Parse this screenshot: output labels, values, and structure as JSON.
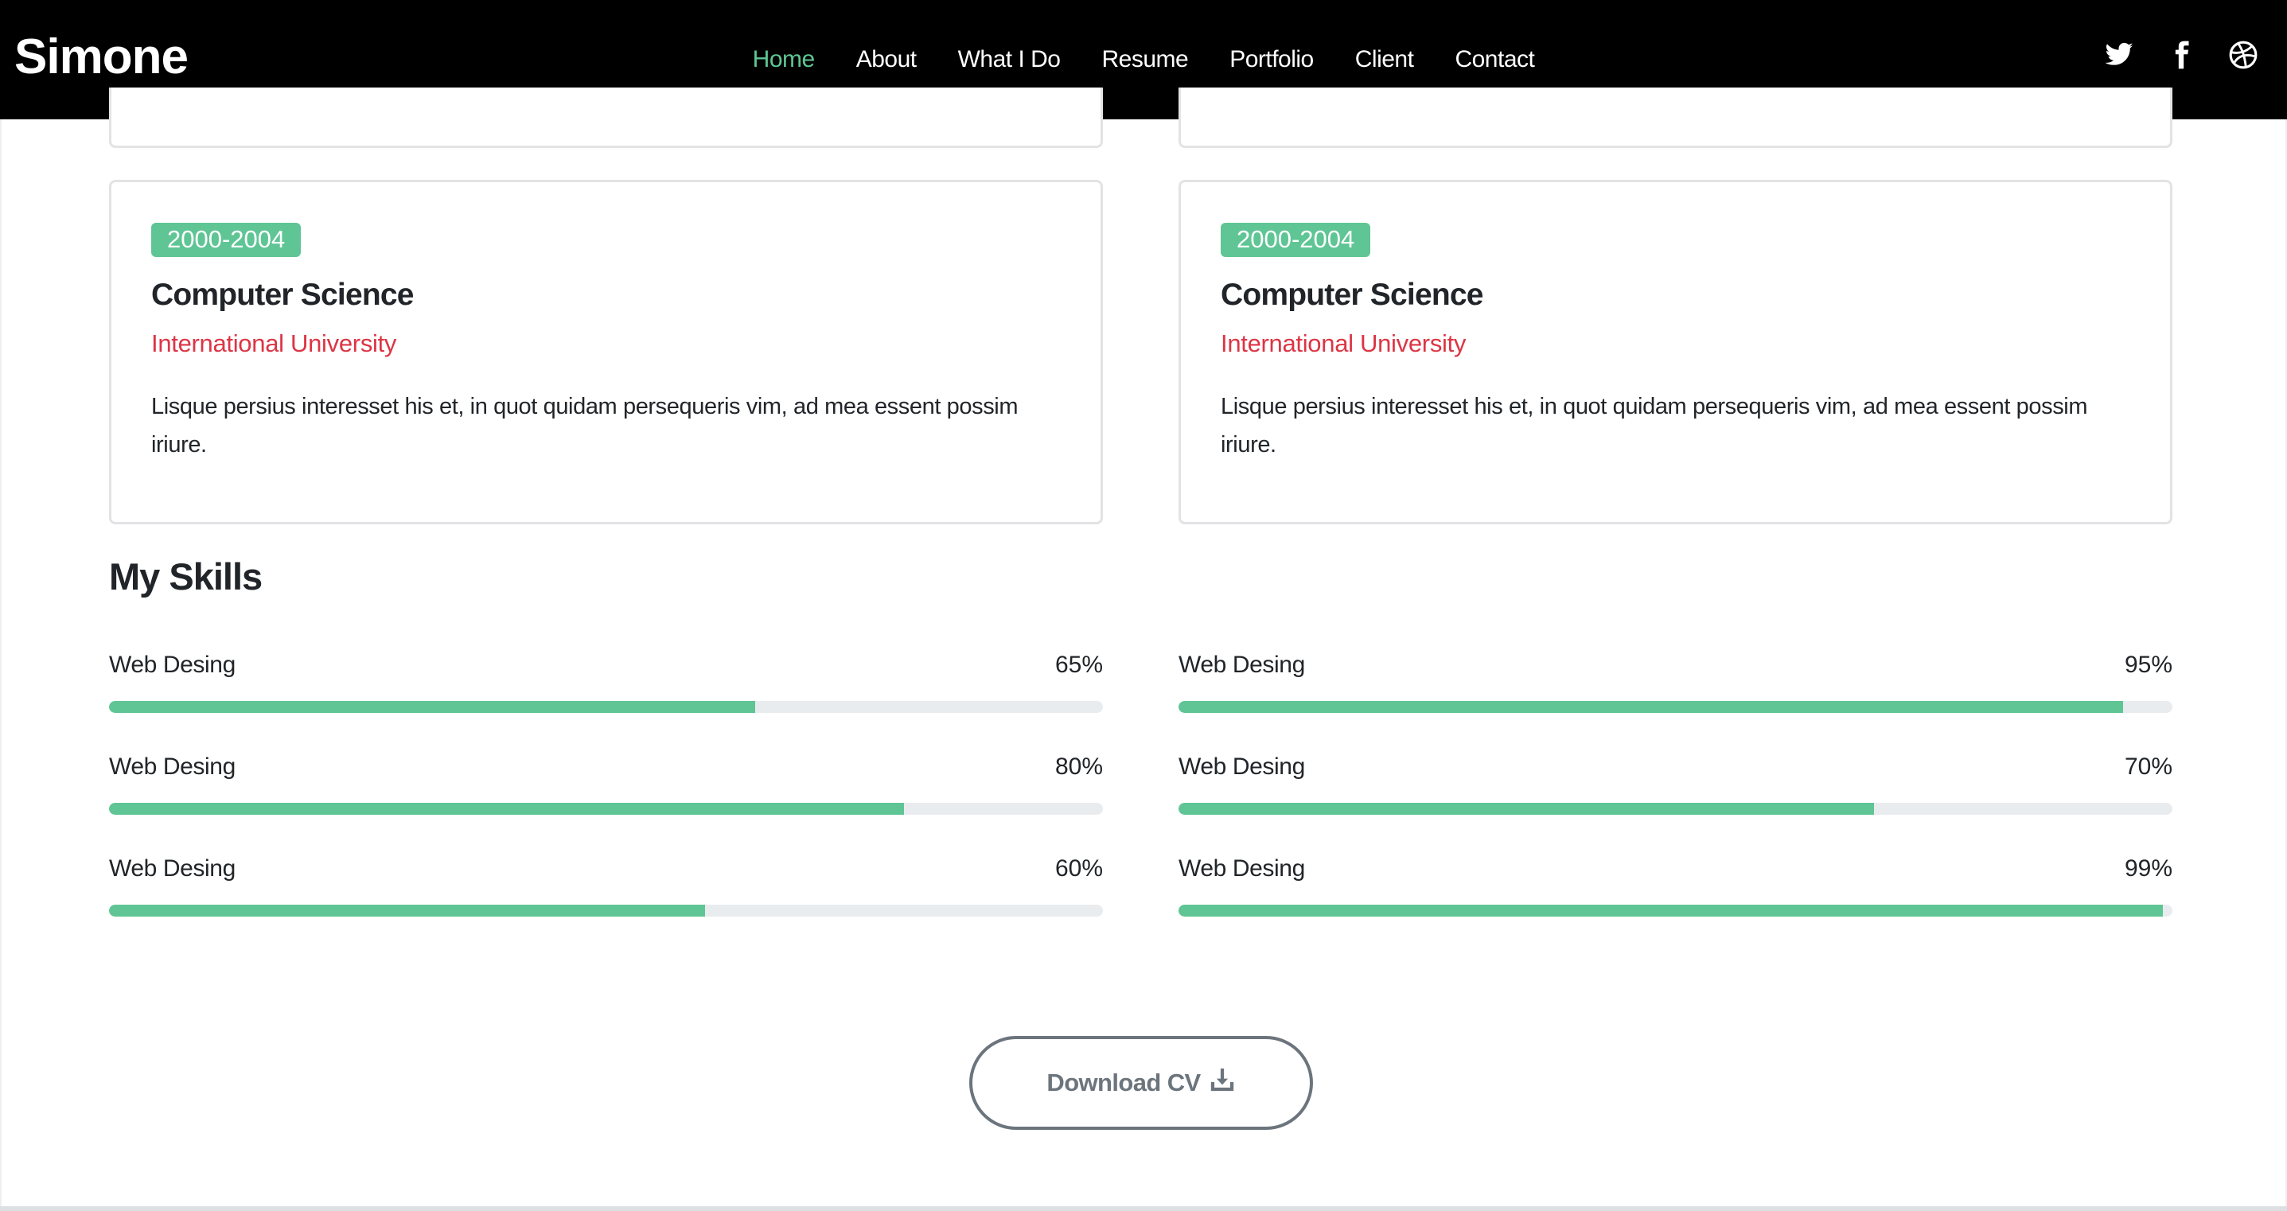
{
  "header": {
    "brand": "Simone",
    "nav": [
      {
        "label": "Home",
        "active": true
      },
      {
        "label": "About",
        "active": false
      },
      {
        "label": "What I Do",
        "active": false
      },
      {
        "label": "Resume",
        "active": false
      },
      {
        "label": "Portfolio",
        "active": false
      },
      {
        "label": "Client",
        "active": false
      },
      {
        "label": "Contact",
        "active": false
      }
    ],
    "social_icons": [
      "twitter-icon",
      "facebook-icon",
      "dribbble-icon"
    ]
  },
  "education": [
    {
      "years": "2000-2004",
      "title": "Computer Science",
      "institution": "International University",
      "description": "Lisque persius interesset his et, in quot quidam persequeris vim, ad mea essent possim iriure."
    },
    {
      "years": "2000-2004",
      "title": "Computer Science",
      "institution": "International University",
      "description": "Lisque persius interesset his et, in quot quidam persequeris vim, ad mea essent possim iriure."
    }
  ],
  "skills": {
    "title": "My Skills",
    "items": [
      {
        "label": "Web Desing",
        "percent_text": "65%",
        "value": 65
      },
      {
        "label": "Web Desing",
        "percent_text": "95%",
        "value": 95
      },
      {
        "label": "Web Desing",
        "percent_text": "80%",
        "value": 80
      },
      {
        "label": "Web Desing",
        "percent_text": "70%",
        "value": 70
      },
      {
        "label": "Web Desing",
        "percent_text": "60%",
        "value": 60
      },
      {
        "label": "Web Desing",
        "percent_text": "99%",
        "value": 99
      }
    ]
  },
  "download_button": {
    "label": "Download CV",
    "icon": "download-icon"
  },
  "colors": {
    "accent": "#5fc595",
    "institution": "#dc3545",
    "navbar_bg": "#000000",
    "button_border": "#6c757d"
  }
}
